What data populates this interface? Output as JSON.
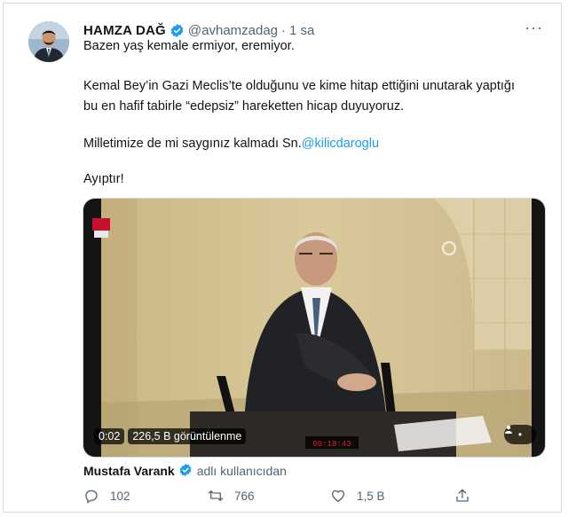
{
  "tweet": {
    "author_name": "HAMZA DAĞ",
    "handle": "@avhamzadag",
    "separator": "·",
    "time": "1 sa",
    "more": "···",
    "lines": [
      "Bazen yaş kemale ermiyor, eremiyor.",
      "Kemal Bey’in Gazi Meclis’te olduğunu ve kime hitap ettiğini unutarak yaptığı",
      "bu en hafif tabirle “edepsiz” hareketten hicap duyuyoruz.",
      "Milletimize de mi saygınız kalmadı Sn.",
      "Ayıptır!"
    ],
    "mention": "@kilicdaroglu"
  },
  "media": {
    "duration": "0:02",
    "views": "226,5 B görüntülenme",
    "timer": "00:18:43"
  },
  "tagged": {
    "name": "Mustafa Varank",
    "suffix": "adlı kullanıcıdan"
  },
  "actions": {
    "replies": "102",
    "retweets": "766",
    "likes": "1,5 B"
  },
  "colors": {
    "accent": "#1d9bf0",
    "secondary_text": "#536471",
    "border": "#cfd9de"
  },
  "icons": [
    "verified-badge-icon",
    "more-icon",
    "reply-icon",
    "retweet-icon",
    "like-icon",
    "share-icon",
    "person-icon"
  ]
}
